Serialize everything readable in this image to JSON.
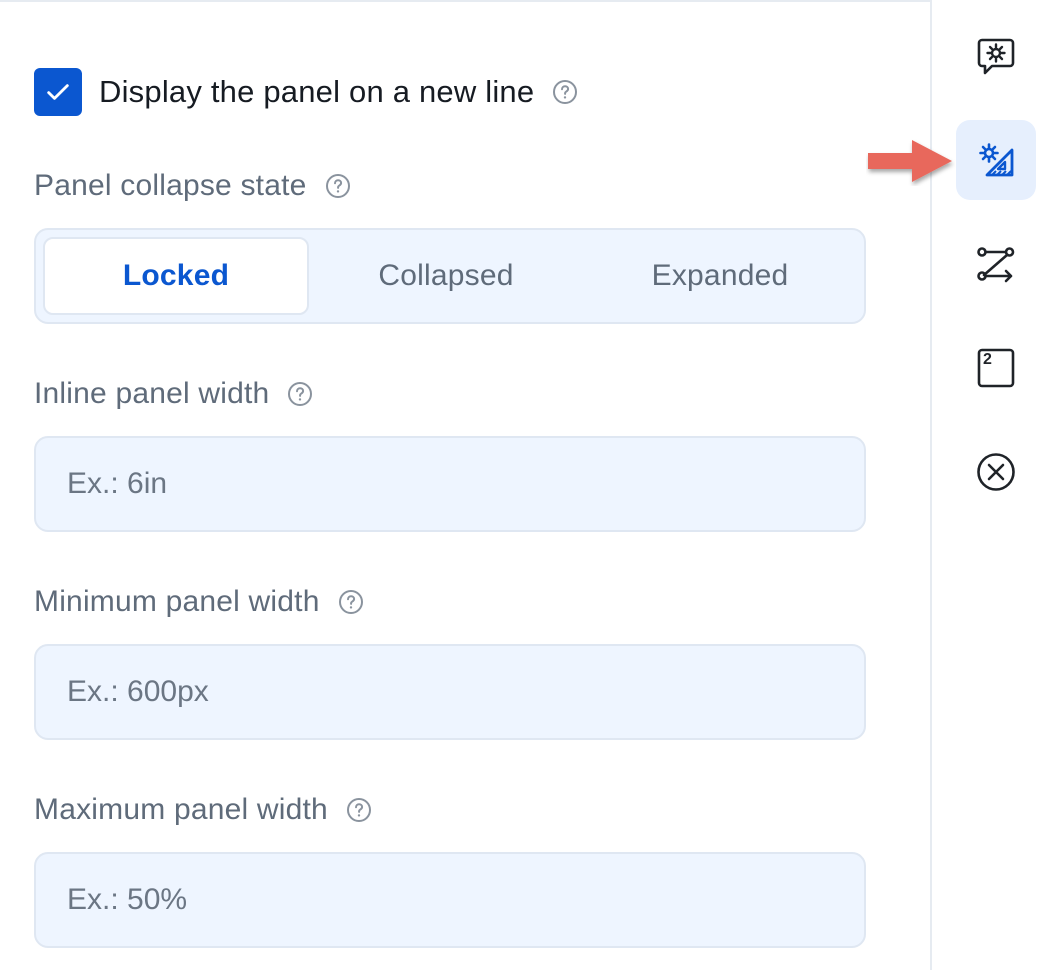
{
  "display_new_line": {
    "checked": true,
    "label": "Display the panel on a new line"
  },
  "collapse_state": {
    "label": "Panel collapse state",
    "options": [
      "Locked",
      "Collapsed",
      "Expanded"
    ],
    "selected": "Locked"
  },
  "inline_width": {
    "label": "Inline panel width",
    "placeholder": "Ex.: 6in",
    "value": ""
  },
  "min_width": {
    "label": "Minimum panel width",
    "placeholder": "Ex.: 600px",
    "value": ""
  },
  "max_width": {
    "label": "Maximum panel width",
    "placeholder": "Ex.: 50%",
    "value": ""
  },
  "rail": {
    "items": [
      {
        "icon": "chat-settings-icon",
        "active": false
      },
      {
        "icon": "layout-settings-icon",
        "active": true
      },
      {
        "icon": "logic-path-icon",
        "active": false
      },
      {
        "icon": "numbered-box-icon",
        "badge": "2",
        "active": false
      },
      {
        "icon": "close-circle-icon",
        "active": false
      }
    ]
  },
  "colors": {
    "accent": "#0b57d0",
    "arrow": "#e8685c",
    "input_bg": "#eef5ff",
    "label": "#5f6b7a"
  }
}
